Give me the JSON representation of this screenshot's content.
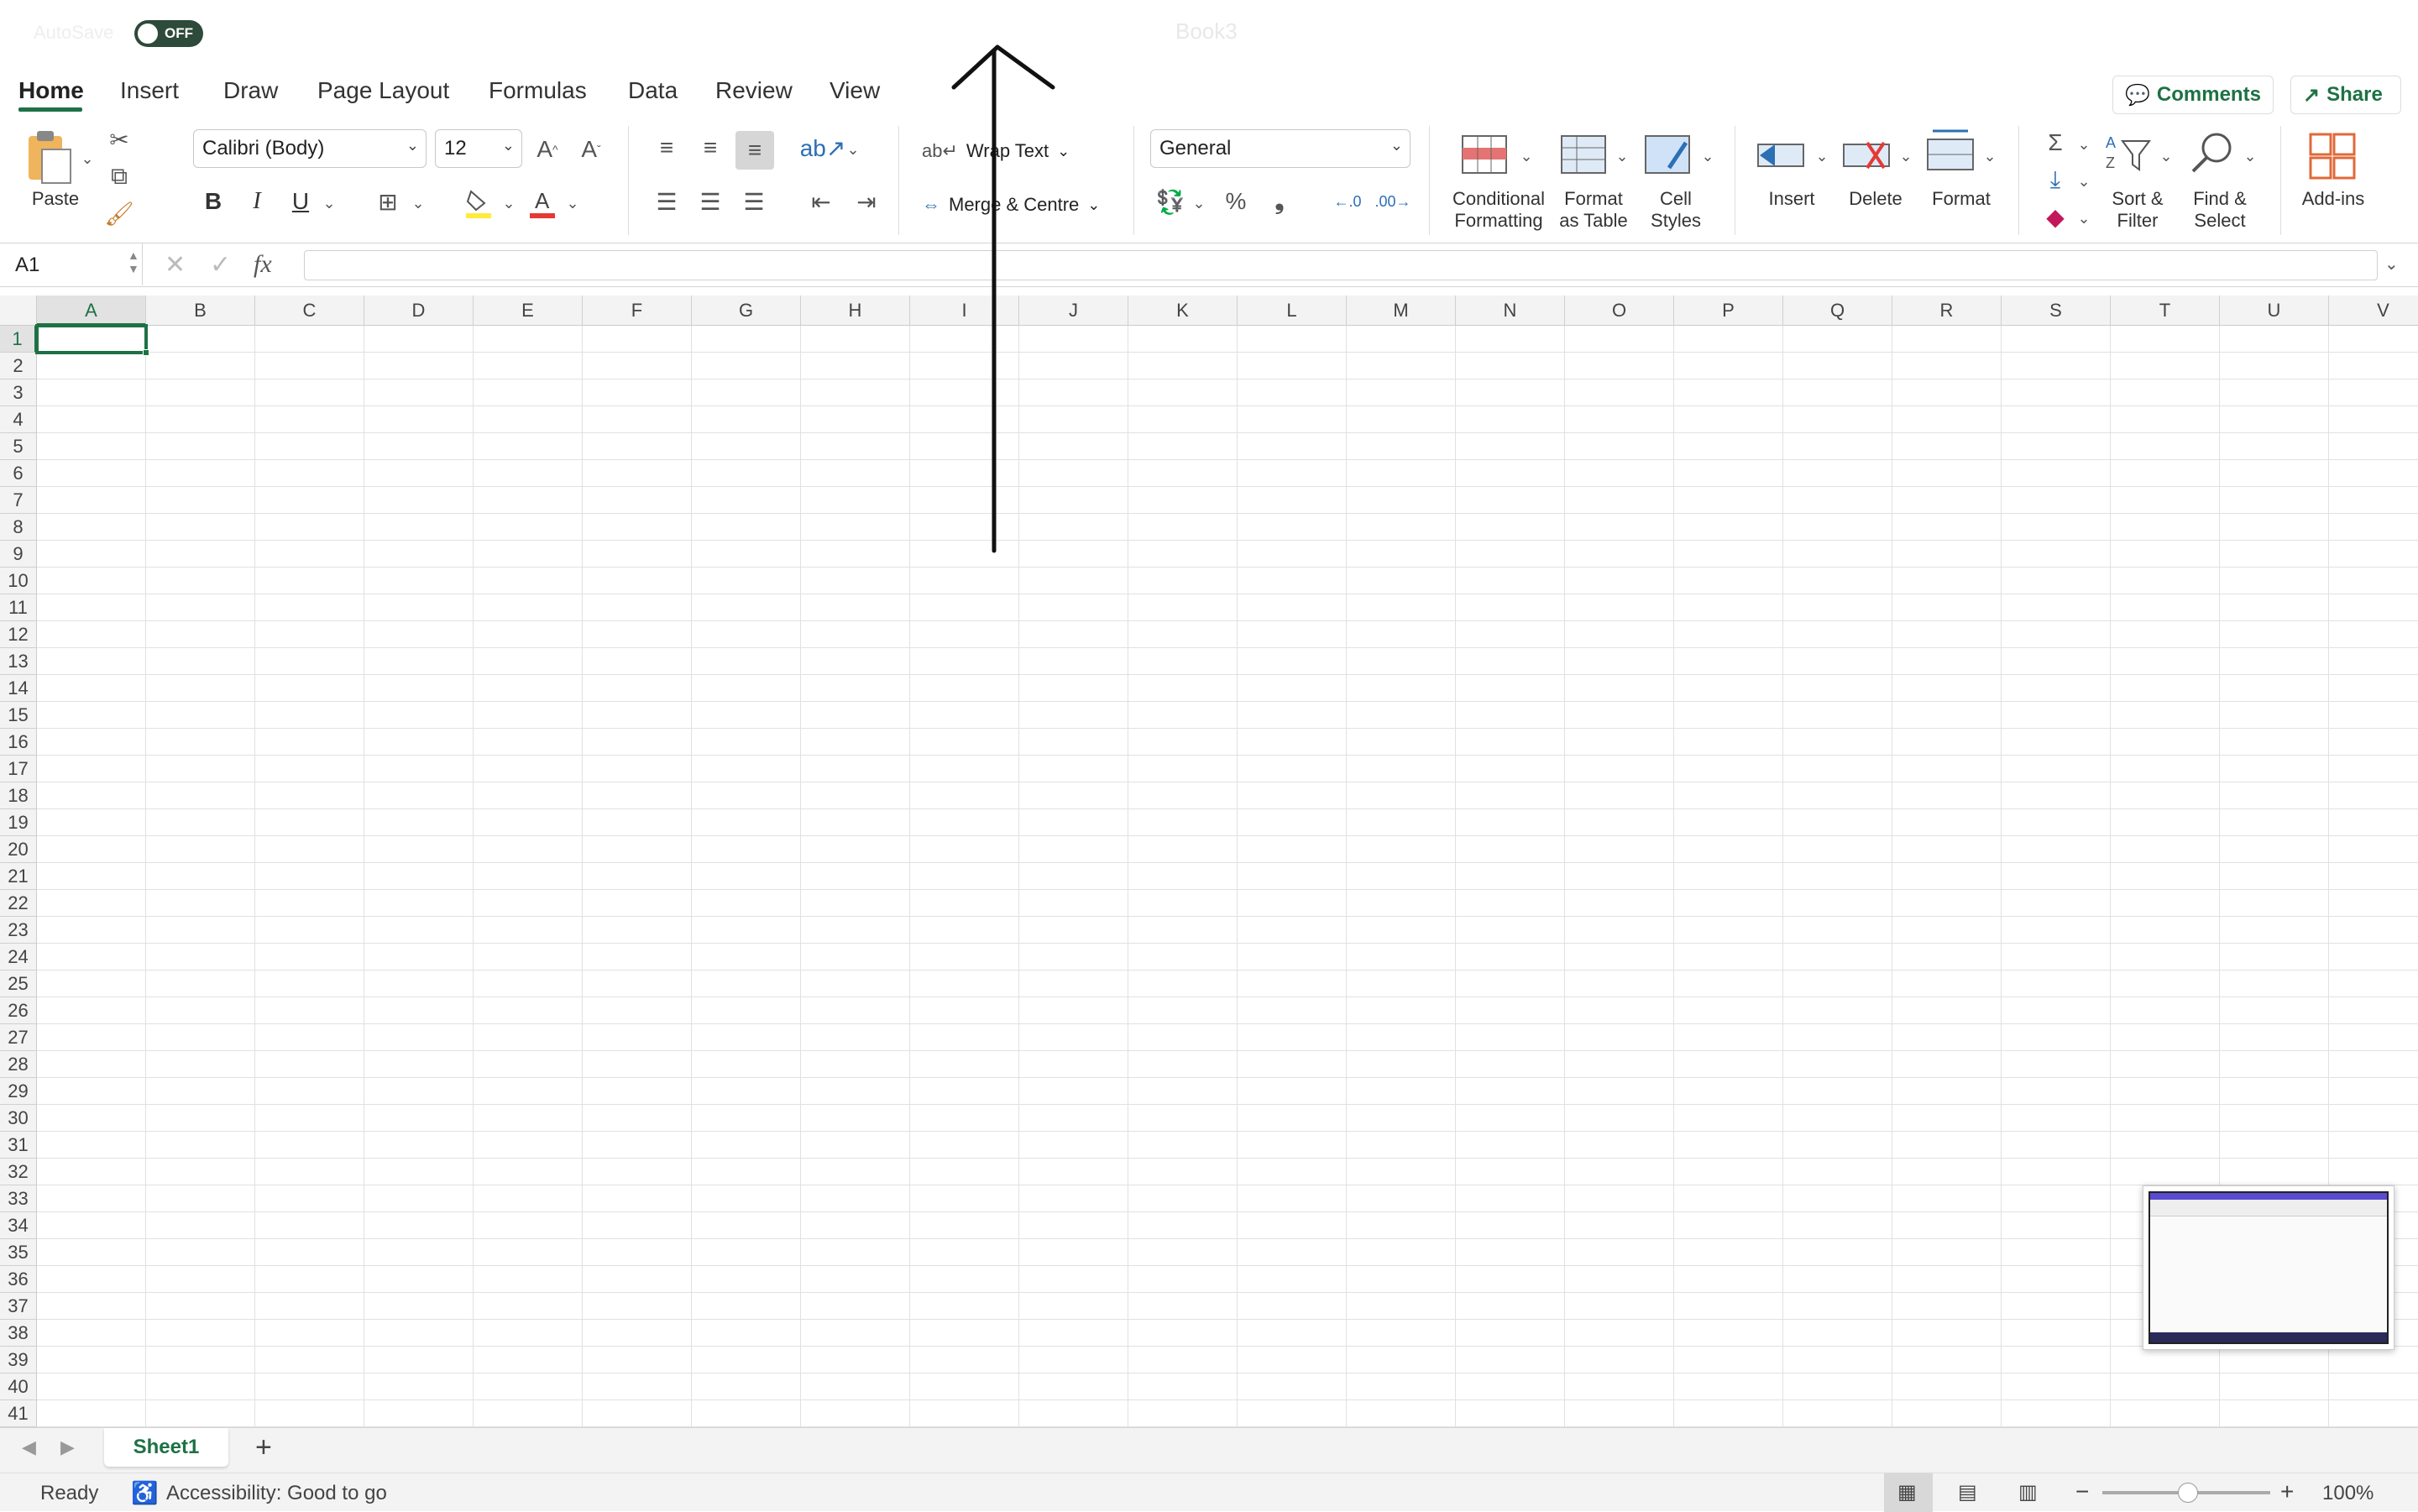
{
  "titlebar": {
    "autosave_label": "AutoSave",
    "toggle_state": "OFF",
    "document_title": "Book3"
  },
  "tabs": [
    "Home",
    "Insert",
    "Draw",
    "Page Layout",
    "Formulas",
    "Data",
    "Review",
    "View"
  ],
  "top_buttons": {
    "comments": "Comments",
    "share": "Share"
  },
  "ribbon": {
    "paste_label": "Paste",
    "font_name": "Calibri (Body)",
    "font_size": "12",
    "bold": "B",
    "italic": "I",
    "underline": "U",
    "wrap_text": "Wrap Text",
    "merge_centre": "Merge & Centre",
    "number_format": "General",
    "percent": "%",
    "comma": "❟",
    "conditional_formatting": [
      "Conditional",
      "Formatting"
    ],
    "format_as_table": [
      "Format",
      "as Table"
    ],
    "cell_styles": [
      "Cell",
      "Styles"
    ],
    "insert": "Insert",
    "delete": "Delete",
    "format": "Format",
    "sort_filter": [
      "Sort &",
      "Filter"
    ],
    "find_select": [
      "Find &",
      "Select"
    ],
    "add_ins": "Add-ins",
    "accent": "#1e7145"
  },
  "formula_bar": {
    "name_box": "A1",
    "fx": "fx",
    "content": ""
  },
  "columns": [
    "A",
    "B",
    "C",
    "D",
    "E",
    "F",
    "G",
    "H",
    "I",
    "J",
    "K",
    "L",
    "M",
    "N",
    "O",
    "P",
    "Q",
    "R",
    "S",
    "T",
    "U",
    "V"
  ],
  "rows": [
    "1",
    "2",
    "3",
    "4",
    "5",
    "6",
    "7",
    "8",
    "9",
    "10",
    "11",
    "12",
    "13",
    "14",
    "15",
    "16",
    "17",
    "18",
    "19",
    "20",
    "21",
    "22",
    "23",
    "24",
    "25",
    "26",
    "27",
    "28",
    "29",
    "30",
    "31",
    "32",
    "33",
    "34",
    "35",
    "36",
    "37",
    "38",
    "39",
    "40",
    "41"
  ],
  "selected_cell": "A1",
  "sheets": [
    "Sheet1"
  ],
  "add_sheet": "+",
  "status": {
    "ready": "Ready",
    "accessibility": "Accessibility: Good to go",
    "zoom": "100%",
    "zoom_minus": "−",
    "zoom_plus": "+"
  }
}
